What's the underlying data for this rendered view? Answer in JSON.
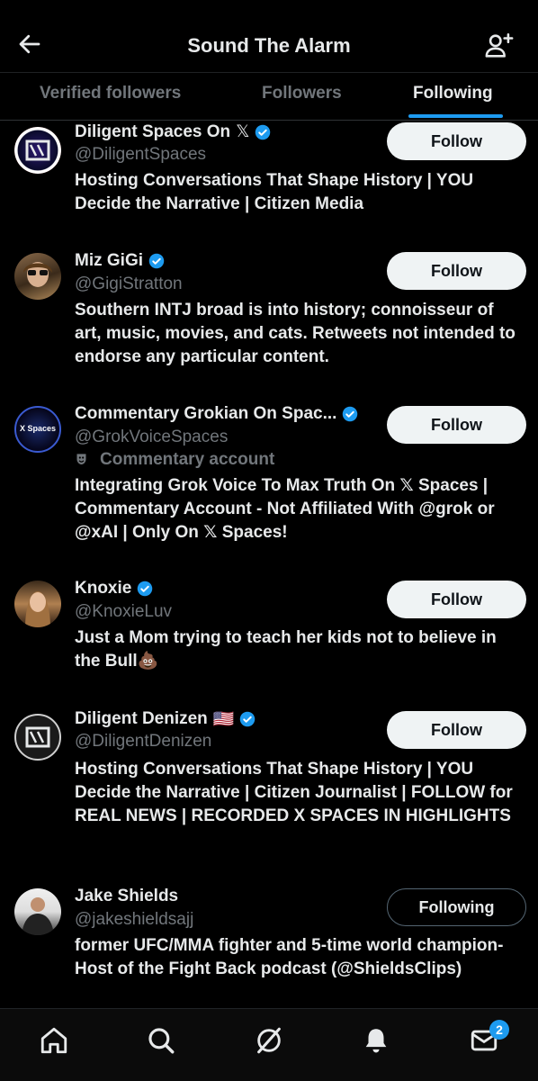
{
  "header": {
    "title": "Sound The Alarm",
    "back_icon": "arrow-left-icon",
    "add_icon": "person-add-icon"
  },
  "tabs": [
    {
      "label": "Verified followers",
      "active": false
    },
    {
      "label": "Followers",
      "active": false
    },
    {
      "label": "Following",
      "active": true
    }
  ],
  "accounts": [
    {
      "name": "Diligent Spaces On",
      "name_suffix": "𝕏",
      "handle": "@DiligentSpaces",
      "bio": "Hosting Conversations That Shape History | YOU Decide the Narrative | Citizen Media",
      "button": "Follow",
      "verified": true
    },
    {
      "name": "Miz GiGi",
      "handle": "@GigiStratton",
      "bio": "Southern INTJ broad is into history; connoisseur of art, music, movies, and cats. Retweets not intended to endorse any particular content.",
      "button": "Follow",
      "verified": true
    },
    {
      "name": "Commentary Grokian On Spac...",
      "handle": "@GrokVoiceSpaces",
      "label": "Commentary account",
      "bio": "Integrating Grok Voice To Max Truth On 𝕏 Spaces | Commentary Account - Not Affiliated With @grok or @xAI | Only On 𝕏 Spaces!",
      "button": "Follow",
      "verified": true,
      "avatar_text": "X Spaces"
    },
    {
      "name": "Knoxie",
      "handle": "@KnoxieLuv",
      "bio": "Just a Mom trying to teach her kids not to believe in the Bull💩",
      "button": "Follow",
      "verified": true
    },
    {
      "name": "Diligent Denizen",
      "name_suffix": "🇺🇸",
      "handle": "@DiligentDenizen",
      "bio": "Hosting Conversations That Shape History | YOU Decide the Narrative | Citizen Journalist | FOLLOW for REAL NEWS | RECORDED X SPACES IN HIGHLIGHTS",
      "button": "Follow",
      "verified": true
    },
    {
      "name": "Jake Shields",
      "handle": "@jakeshieldsajj",
      "bio": "former UFC/MMA fighter and 5-time world champion- Host of the Fight Back podcast (@ShieldsClips)",
      "button": "Following",
      "verified": false
    }
  ],
  "bottom_nav": {
    "items": [
      "home-icon",
      "search-icon",
      "grok-icon",
      "notifications-icon",
      "messages-icon"
    ],
    "messages_badge": "2"
  },
  "colors": {
    "accent": "#1d9bf0",
    "background": "#000000",
    "text": "#e7e9ea",
    "muted": "#71767b"
  }
}
